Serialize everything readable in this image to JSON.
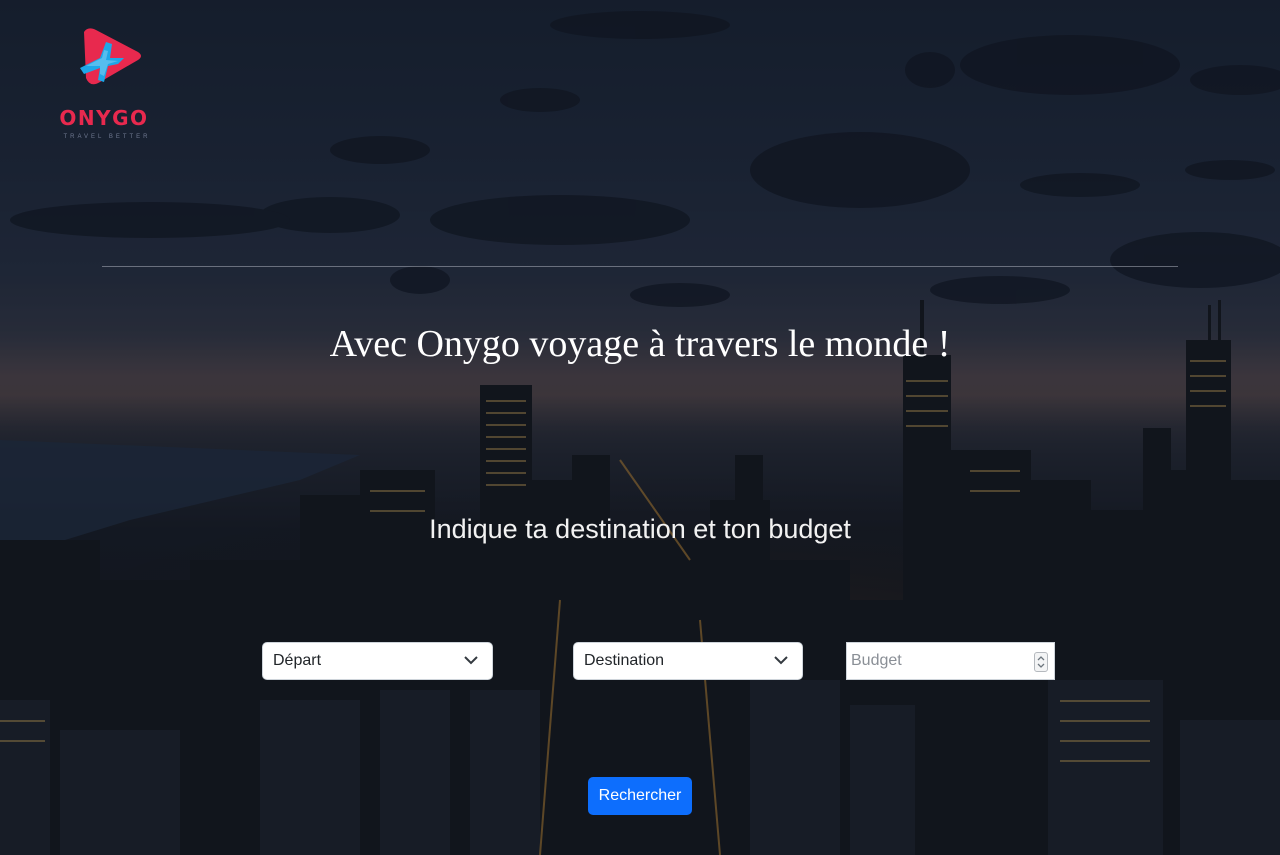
{
  "brand": {
    "name": "ONYGO",
    "tagline": "TRAVEL BETTER",
    "logo_icon": "plane-play-icon",
    "accent_color": "#e8294e",
    "secondary_color": "#1ea7e8"
  },
  "hero": {
    "title": "Avec Onygo voyage à travers le monde !",
    "subtitle": "Indique ta destination et ton budget",
    "background": "night-city-skyline"
  },
  "search": {
    "departure": {
      "label": "Départ",
      "icon": "chevron-down-icon"
    },
    "destination": {
      "label": "Destination",
      "icon": "chevron-down-icon"
    },
    "budget": {
      "placeholder": "Budget",
      "icon": "number-spinner-icon"
    },
    "submit_label": "Rechercher",
    "button_color": "#0d6efd"
  }
}
